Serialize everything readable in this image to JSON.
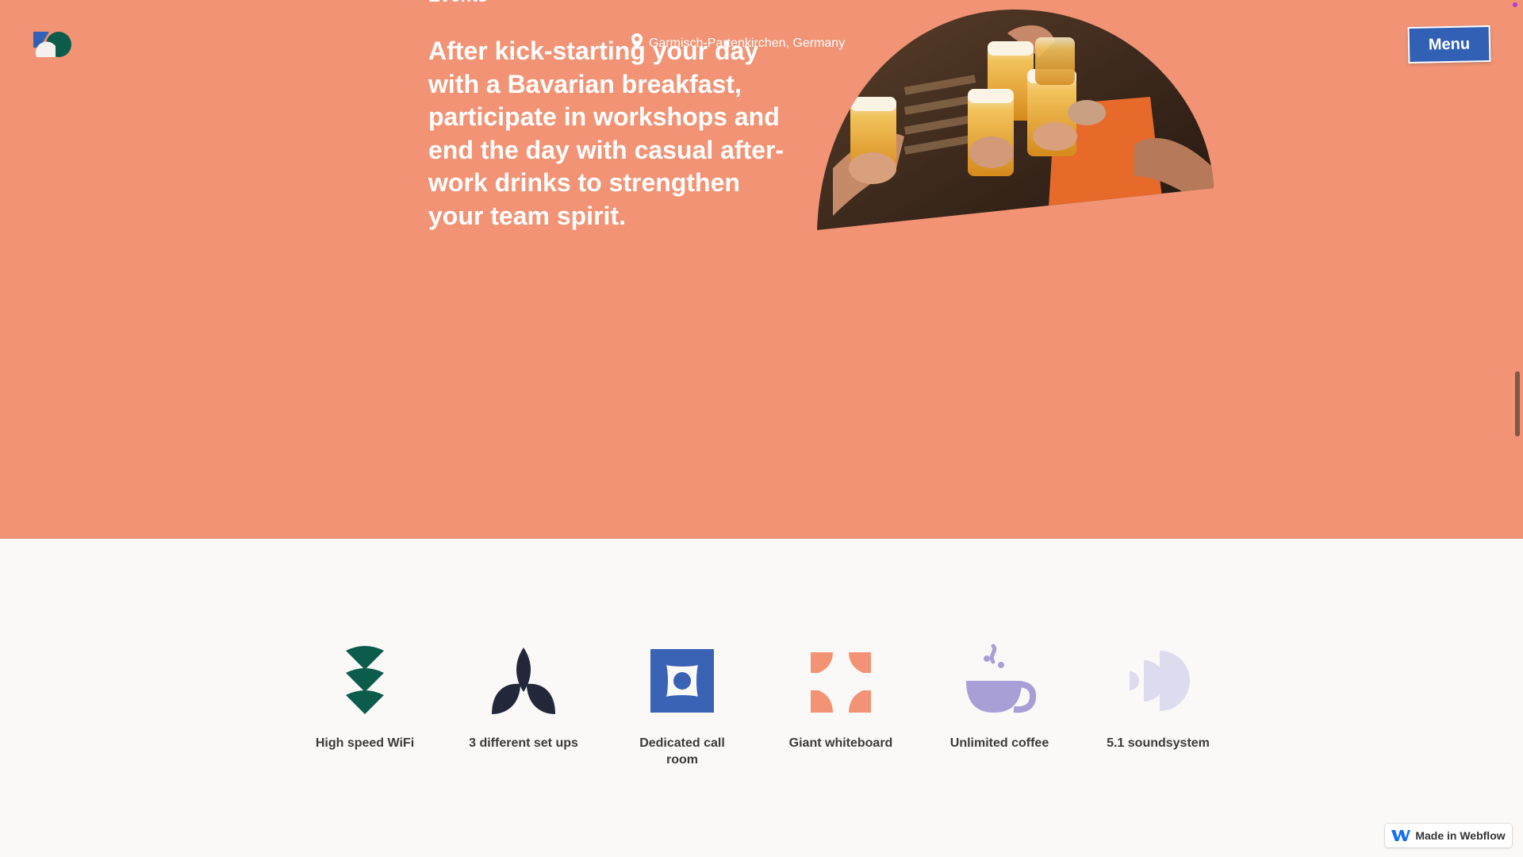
{
  "header": {
    "logo_icon": "brand-logo-icon",
    "menu_label": "Menu"
  },
  "hero": {
    "kicker": "Events",
    "location": "Garmisch-Partenkirchen, Germany",
    "body": "After kick-starting your day with a Bavarian breakfast, participate in workshops and end the day with casual after-work drinks to strengthen your team spirit.",
    "background_color": "#f19374",
    "photo_icon": "friends-toasting-beer-photo"
  },
  "amenities": {
    "items": [
      {
        "label": "High speed WiFi",
        "icon": "wifi-icon",
        "color": "#0b5c4a"
      },
      {
        "label": "3 different set ups",
        "icon": "leaves-icon",
        "color": "#22283a"
      },
      {
        "label": "Dedicated call room",
        "icon": "call-room-icon",
        "color": "#3a62b5"
      },
      {
        "label": "Giant whiteboard",
        "icon": "whiteboard-icon",
        "color": "#f19374"
      },
      {
        "label": "Unlimited coffee",
        "icon": "coffee-cup-icon",
        "color": "#a79fd6"
      },
      {
        "label": "5.1 soundsystem",
        "icon": "sound-icon",
        "color": "#dcdcee"
      }
    ]
  },
  "badge": {
    "label": "Made in Webflow",
    "icon": "webflow-icon"
  },
  "colors": {
    "accent_blue": "#3160b4",
    "hero_salmon": "#f19374"
  }
}
